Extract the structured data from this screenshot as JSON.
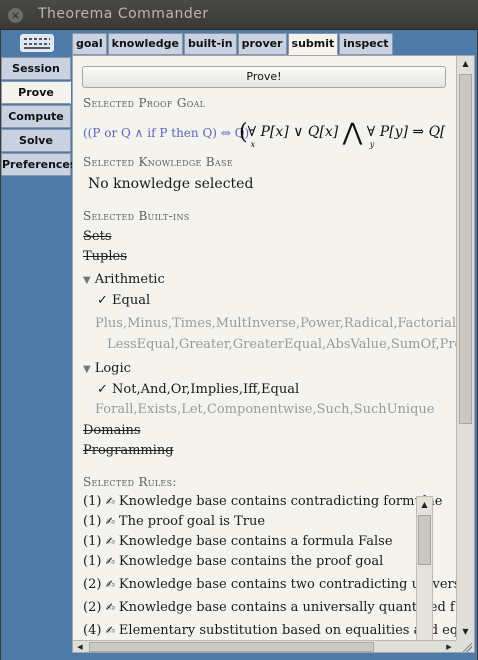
{
  "window": {
    "title": "Theorema Commander"
  },
  "sidebar": {
    "tabs": [
      {
        "label": "Session",
        "active": false
      },
      {
        "label": "Prove",
        "active": true
      },
      {
        "label": "Compute",
        "active": false
      },
      {
        "label": "Solve",
        "active": false
      },
      {
        "label": "Preferences",
        "active": false
      }
    ]
  },
  "toptabs": [
    {
      "label": "goal",
      "active": false
    },
    {
      "label": "knowledge",
      "active": false
    },
    {
      "label": "built-in",
      "active": false
    },
    {
      "label": "prover",
      "active": false
    },
    {
      "label": "submit",
      "active": true
    },
    {
      "label": "inspect",
      "active": false
    }
  ],
  "prove_button": "Prove!",
  "proof_goal": {
    "heading": "Selected Proof Goal",
    "label": "((P or Q ∧ if P then Q) ⇔ Q)",
    "formula_part1": "P[x] ∨ Q[x]",
    "formula_part2": "P[y] ⇒ Q[",
    "quantifier": "∀",
    "var1": "x",
    "var2": "y",
    "wedge": "⋀",
    "paren": "("
  },
  "knowledge_base": {
    "heading": "Selected Knowledge Base",
    "text": "No knowledge selected"
  },
  "builtins": {
    "heading": "Selected Built-ins",
    "sets": "Sets",
    "tuples": "Tuples",
    "arithmetic": {
      "label": "Arithmetic",
      "checked": "✓ Equal",
      "line1": "Plus,Minus,Times,MultInverse,Power,Radical,Factorial,Le",
      "line2": "LessEqual,Greater,GreaterEqual,AbsValue,SumOf,Prod"
    },
    "logic": {
      "label": "Logic",
      "checked": "✓ Not,And,Or,Implies,Iff,Equal",
      "line1": "Forall,Exists,Let,Componentwise,Such,SuchUnique"
    },
    "domains": "Domains",
    "programming": "Programming"
  },
  "rules": {
    "heading": "Selected Rules:",
    "items": [
      {
        "prio": "(1)",
        "text": "Knowledge base contains contradicting formulae"
      },
      {
        "prio": "(1)",
        "text": "The proof goal is True"
      },
      {
        "prio": "(1)",
        "text": "Knowledge base contains a formula False"
      },
      {
        "prio": "(1)",
        "text": "Knowledge base contains the proof goal"
      },
      {
        "prio": "(2)",
        "text": "Knowledge base contains two contradicting univers"
      },
      {
        "prio": "(2)",
        "text": "Knowledge base contains a universally quantified f"
      },
      {
        "prio": "(4)",
        "text": "Elementary substitution based on equalities and eq"
      }
    ]
  },
  "icons": {
    "close": "close-icon",
    "keyboard": "keyboard-icon",
    "expand": "triangle-down-icon",
    "rule": "hand-writing-icon"
  }
}
